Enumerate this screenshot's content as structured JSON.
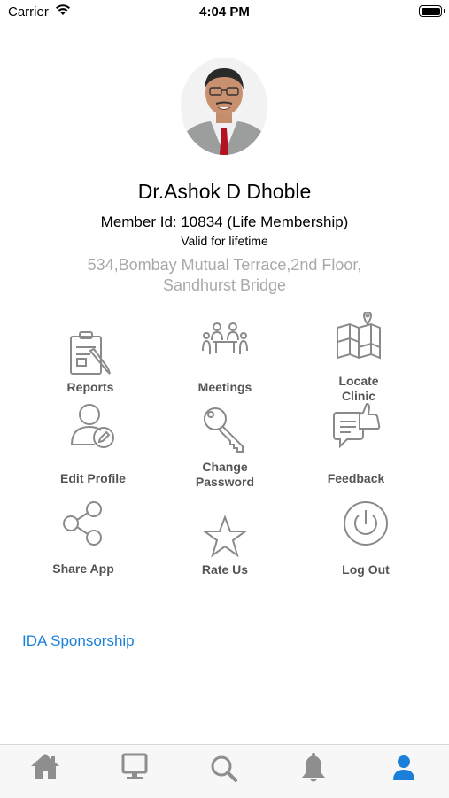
{
  "status_bar": {
    "carrier": "Carrier",
    "time": "4:04 PM"
  },
  "profile": {
    "name": "Dr.Ashok D Dhoble",
    "member_id": "Member Id: 10834 (Life Membership)",
    "validity": "Valid for lifetime",
    "address_line1": "534,Bombay Mutual Terrace,2nd Floor,",
    "address_line2": "Sandhurst Bridge"
  },
  "menu": {
    "reports": "Reports",
    "meetings": "Meetings",
    "locate_clinic_1": "Locate",
    "locate_clinic_2": "Clinic",
    "edit_profile": "Edit Profile",
    "change_password_1": "Change",
    "change_password_2": "Password",
    "feedback": "Feedback",
    "share_app": "Share App",
    "rate_us": "Rate Us",
    "log_out": "Log Out"
  },
  "sponsorship_link": "IDA Sponsorship",
  "tab_bar": {
    "tabs": [
      "home-icon",
      "monitor-icon",
      "search-icon",
      "bell-icon",
      "user-icon"
    ],
    "active_index": 4,
    "active_color": "#1a7fd8",
    "inactive_color": "#8e8e8e"
  },
  "colors": {
    "link": "#1a7fd8",
    "label": "#555555",
    "icon": "#8a8a8a",
    "address": "#a9a9a9"
  }
}
